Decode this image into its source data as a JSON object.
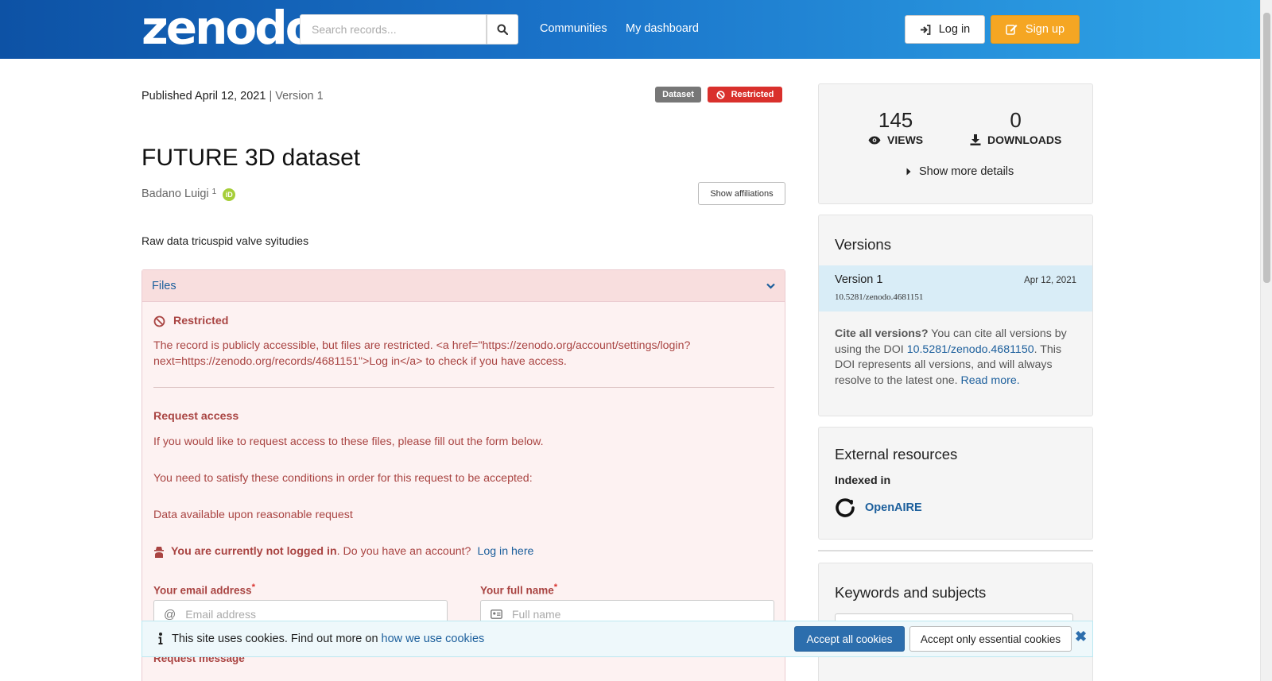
{
  "header": {
    "logo": "zenodo",
    "search_placeholder": "Search records...",
    "nav": [
      "Communities",
      "My dashboard"
    ],
    "login_label": "Log in",
    "signup_label": "Sign up"
  },
  "record": {
    "published": "Published April 12, 2021",
    "version": "| Version 1",
    "badge_type": "Dataset",
    "badge_access": "Restricted",
    "title": "FUTURE 3D dataset",
    "author": "Badano Luigi",
    "author_affil_num": "1",
    "orcid_label": "iD",
    "show_affiliations": "Show affiliations",
    "description": "Raw data tricuspid valve syitudies"
  },
  "files": {
    "header": "Files",
    "restricted_title": "Restricted",
    "restricted_text": "The record is publicly accessible, but files are restricted. <a href=\"https://zenodo.org/account/settings/login?next=https://zenodo.org/records/4681151\">Log in</a> to check if you have access.",
    "request_title": "Request access",
    "request_text1": "If you would like to request access to these files, please fill out the form below.",
    "request_text2": "You need to satisfy these conditions in order for this request to be accepted:",
    "request_text3": "Data available upon reasonable request",
    "not_logged_bold": "You are currently not logged in",
    "not_logged_rest": ". Do you have an account?",
    "login_here": "Log in here",
    "email_label": "Your email address",
    "email_placeholder": "Email address",
    "name_label": "Your full name",
    "name_placeholder": "Full name",
    "required_mark": "*",
    "message_label": "Request message"
  },
  "cookies": {
    "text": "This site uses cookies. Find out more on",
    "link": "how we use cookies",
    "accept_all": "Accept all cookies",
    "accept_essential": "Accept only essential cookies",
    "close": "✖"
  },
  "sidebar": {
    "views_count": "145",
    "views_label": "VIEWS",
    "downloads_count": "0",
    "downloads_label": "DOWNLOADS",
    "more_details": "Show more details",
    "versions_title": "Versions",
    "version_name": "Version 1",
    "version_date": "Apr 12, 2021",
    "version_doi": "10.5281/zenodo.4681151",
    "cite_bold": "Cite all versions?",
    "cite_text1": " You can cite all versions by using the DOI ",
    "cite_doi": "10.5281/zenodo.4681150",
    "cite_text2": ". This DOI represents all versions, and will always resolve to the latest one. ",
    "read_more": "Read more.",
    "external_title": "External resources",
    "indexed_in": "Indexed in",
    "openaire": "OpenAIRE",
    "keywords_title": "Keywords and subjects"
  },
  "colors": {
    "header_start": "#0d52a5",
    "header_end": "#2fa6e8",
    "signup": "#f5a623",
    "restricted": "#d9302c",
    "link": "#1c5f9c"
  }
}
